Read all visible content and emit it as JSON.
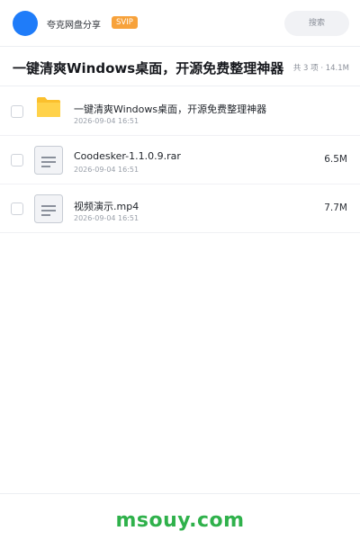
{
  "header": {
    "brand": "夸克网盘分享",
    "vip_badge": "SVIP",
    "search_label": "搜索"
  },
  "share": {
    "title": "一键清爽Windows桌面，开源免费整理神器",
    "summary": "共 3 项 · 14.1M"
  },
  "files": [
    {
      "name": "一键清爽Windows桌面，开源免费整理神器",
      "date": "2026-09-04 16:51",
      "size": "",
      "icon": "folder-icon"
    },
    {
      "name": "Coodesker-1.1.0.9.rar",
      "date": "2026-09-04 16:51",
      "size": "6.5M",
      "icon": "file-icon"
    },
    {
      "name": "视频演示.mp4",
      "date": "2026-09-04 16:51",
      "size": "7.7M",
      "icon": "file-icon"
    }
  ],
  "footer": {
    "watermark": "msouy.com"
  },
  "colors": {
    "accent": "#1f7cf9",
    "vip": "#f7a23b",
    "watermark": "#2fb14b",
    "folder": "#fbc02d"
  }
}
